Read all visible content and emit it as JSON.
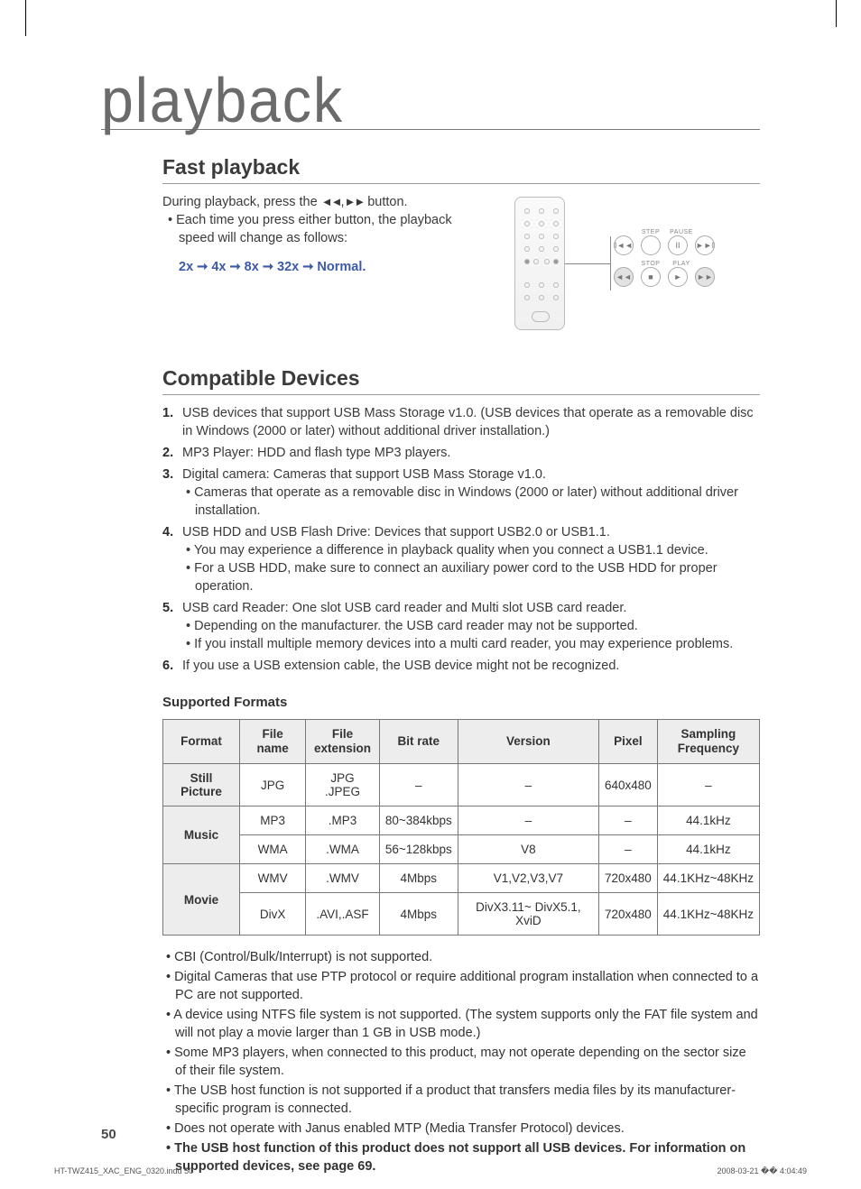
{
  "page": {
    "title": "playback",
    "number": "50"
  },
  "fast": {
    "heading": "Fast playback",
    "intro_a": "During playback, press the ",
    "intro_b": " button.",
    "bullet": "Each time you press either button, the playback speed will change as follows:",
    "speed": "2x ➞ 4x ➞ 8x ➞ 32x ➞ Normal.",
    "labels": {
      "step": "STEP",
      "pause": "PAUSE",
      "stop": "STOP",
      "play": "PLAY"
    }
  },
  "compat": {
    "heading": "Compatible Devices",
    "items": [
      {
        "text": "USB devices that support USB Mass Storage v1.0. (USB devices that operate as a removable disc in Windows (2000 or later) without additional driver installation.)",
        "subs": []
      },
      {
        "text": "MP3 Player: HDD and flash type MP3 players.",
        "subs": []
      },
      {
        "text": "Digital camera: Cameras that support USB Mass Storage v1.0.",
        "subs": [
          "Cameras that operate as a removable disc in Windows (2000 or later) without additional driver installation."
        ]
      },
      {
        "text": "USB HDD and USB Flash Drive: Devices that support USB2.0 or USB1.1.",
        "subs": [
          "You may experience a difference in playback quality when you connect a USB1.1 device.",
          "For a USB HDD, make sure to connect an auxiliary power cord to the USB HDD for proper operation."
        ]
      },
      {
        "text": "USB card Reader: One slot USB card reader and Multi slot USB card reader.",
        "subs": [
          "Depending on the manufacturer. the USB card reader may not be supported.",
          "If you install multiple memory devices into a multi card reader, you may experience problems."
        ]
      },
      {
        "text": "If you use a USB extension cable, the USB device might not be recognized.",
        "subs": []
      }
    ]
  },
  "formats": {
    "subtitle": "Supported Formats",
    "headers": [
      "Format",
      "File name",
      "File extension",
      "Bit rate",
      "Version",
      "Pixel",
      "Sampling Frequency"
    ],
    "groups": [
      {
        "format": "Still Picture",
        "rows": [
          {
            "name": "JPG",
            "ext": "JPG  .JPEG",
            "bitrate": "–",
            "version": "–",
            "pixel": "640x480",
            "freq": "–"
          }
        ]
      },
      {
        "format": "Music",
        "rows": [
          {
            "name": "MP3",
            "ext": ".MP3",
            "bitrate": "80~384kbps",
            "version": "–",
            "pixel": "–",
            "freq": "44.1kHz"
          },
          {
            "name": "WMA",
            "ext": ".WMA",
            "bitrate": "56~128kbps",
            "version": "V8",
            "pixel": "–",
            "freq": "44.1kHz"
          }
        ]
      },
      {
        "format": "Movie",
        "rows": [
          {
            "name": "WMV",
            "ext": ".WMV",
            "bitrate": "4Mbps",
            "version": "V1,V2,V3,V7",
            "pixel": "720x480",
            "freq": "44.1KHz~48KHz"
          },
          {
            "name": "DivX",
            "ext": ".AVI,.ASF",
            "bitrate": "4Mbps",
            "version": "DivX3.11~ DivX5.1, XviD",
            "pixel": "720x480",
            "freq": "44.1KHz~48KHz"
          }
        ]
      }
    ]
  },
  "notes": [
    {
      "text": "CBI (Control/Bulk/Interrupt) is not supported.",
      "bold": false
    },
    {
      "text": "Digital Cameras that use PTP protocol or require additional program installation when connected to a PC are not supported.",
      "bold": false
    },
    {
      "text": "A device using NTFS file system is not supported. (The system supports only the FAT file system and will not play a movie larger than 1 GB in USB mode.)",
      "bold": false
    },
    {
      "text": "Some MP3 players, when connected to this product, may not operate depending on the sector size of their file system.",
      "bold": false
    },
    {
      "text": "The USB host function is not supported if a product that transfers media files by its manufacturer-specific program is connected.",
      "bold": false
    },
    {
      "text": "Does not operate with Janus enabled MTP (Media Transfer Protocol) devices.",
      "bold": false
    },
    {
      "text": "The USB host function of this product does not support all USB devices. For information on supported devices, see page 69.",
      "bold": true
    }
  ],
  "footer": {
    "file": "HT-TWZ415_XAC_ENG_0320.indd   50",
    "date": "2008-03-21   �� 4:04:49"
  }
}
